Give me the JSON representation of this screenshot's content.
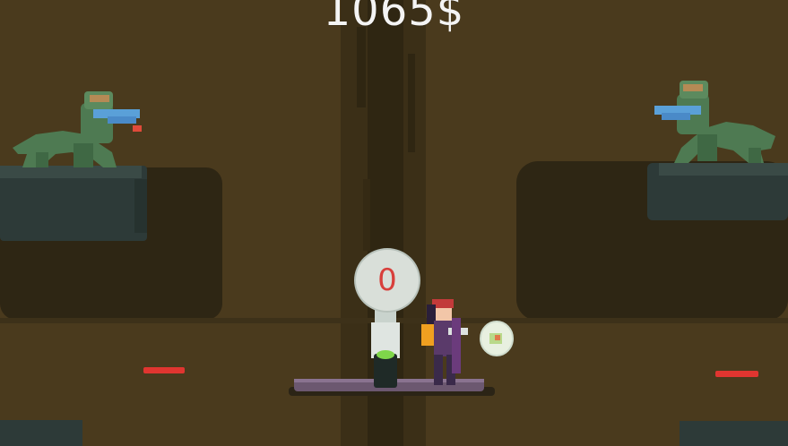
{
  "hud": {
    "money": "1065$"
  },
  "capsule": {
    "counter": "0"
  },
  "colors": {
    "background": "#4a3a1d",
    "dark_band": "#2e2614",
    "ledge": "#2d3a38",
    "lizard": "#4e7a52",
    "gun": "#5aa0d8",
    "hazard": "#e03530",
    "platform": "#6c5870"
  },
  "icons": [
    "lizard-gunner-icon",
    "player-character-icon",
    "capsule-dispenser-icon",
    "coin-pickup-icon"
  ]
}
